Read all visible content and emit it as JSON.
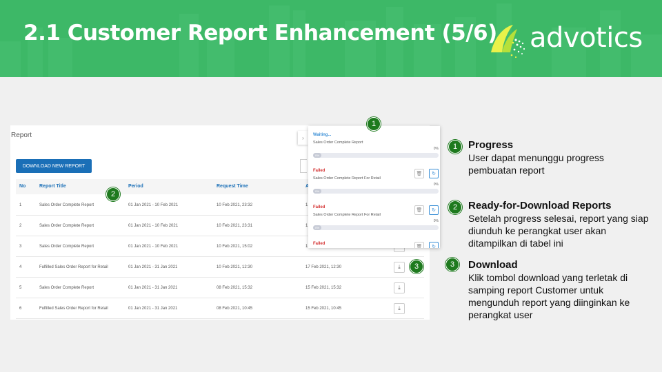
{
  "header": {
    "title": "2.1 Customer Report Enhancement (5/6)",
    "logo_text": "advotics",
    "bg_color": "#3db867"
  },
  "report_page": {
    "title": "Report",
    "download_new_label": "DOWNLOAD NEW REPORT",
    "columns": [
      "No",
      "Report Title",
      "Period",
      "Request Time",
      "A"
    ],
    "rows": [
      {
        "no": "1",
        "title": "Sales Order Complete Report",
        "period": "01 Jan 2021 - 10 Feb 2021",
        "request_time": "10 Feb 2021, 23:32",
        "available": "1"
      },
      {
        "no": "2",
        "title": "Sales Order Complete Report",
        "period": "01 Jan 2021 - 10 Feb 2021",
        "request_time": "10 Feb 2021, 23:31",
        "available": "1"
      },
      {
        "no": "3",
        "title": "Sales Order Complete Report",
        "period": "01 Jan 2021 - 10 Feb 2021",
        "request_time": "10 Feb 2021, 15:02",
        "available": "1"
      },
      {
        "no": "4",
        "title": "Fulfilled Sales Order Report for Retail",
        "period": "01 Jan 2021 - 31 Jan 2021",
        "request_time": "10 Feb 2021, 12:30",
        "available": "17 Feb 2021, 12:30"
      },
      {
        "no": "5",
        "title": "Sales Order Complete Report",
        "period": "01 Jan 2021 - 31 Jan 2021",
        "request_time": "08 Feb 2021, 15:32",
        "available": "15 Feb 2021, 15:32"
      },
      {
        "no": "6",
        "title": "Fulfilled Sales Order Report for Retail",
        "period": "01 Jan 2021 - 31 Jan 2021",
        "request_time": "08 Feb 2021, 10:45",
        "available": "15 Feb 2021, 10:45"
      }
    ]
  },
  "progress_panel": {
    "items": [
      {
        "status": "Waiting...",
        "status_color": "#3a8fd6",
        "name": "Sales Order Complete Report",
        "percent": "0%",
        "bar_label": "0%",
        "progress": 0.05,
        "has_actions": false
      },
      {
        "status": "Failed",
        "status_color": "#d32f2f",
        "name": "Sales Order Complete Report For Retail",
        "percent": "0%",
        "bar_label": "0%",
        "progress": 0.05,
        "has_actions": true
      },
      {
        "status": "Failed",
        "status_color": "#d32f2f",
        "name": "Sales Order Complete Report For Retail",
        "percent": "0%",
        "bar_label": "0%",
        "progress": 0.05,
        "has_actions": true
      },
      {
        "status": "Failed",
        "status_color": "#d32f2f",
        "name": "",
        "percent": "",
        "bar_label": "",
        "progress": 0,
        "has_actions": true
      }
    ]
  },
  "markers": [
    "1",
    "2",
    "3"
  ],
  "descriptions": [
    {
      "num": "1",
      "title": "Progress",
      "lines": [
        "User dapat menunggu progress",
        "pembuatan report"
      ]
    },
    {
      "num": "2",
      "title": "Ready-for-Download Reports",
      "lines": [
        "Setelah progress selesai, report yang siap",
        "diunduh ke perangkat user akan",
        "ditampilkan di tabel ini"
      ]
    },
    {
      "num": "3",
      "title": "Download",
      "lines": [
        "Klik tombol download yang terletak di",
        "samping report Customer untuk",
        "mengunduh report yang diinginkan  ke",
        "perangkat user"
      ]
    }
  ]
}
